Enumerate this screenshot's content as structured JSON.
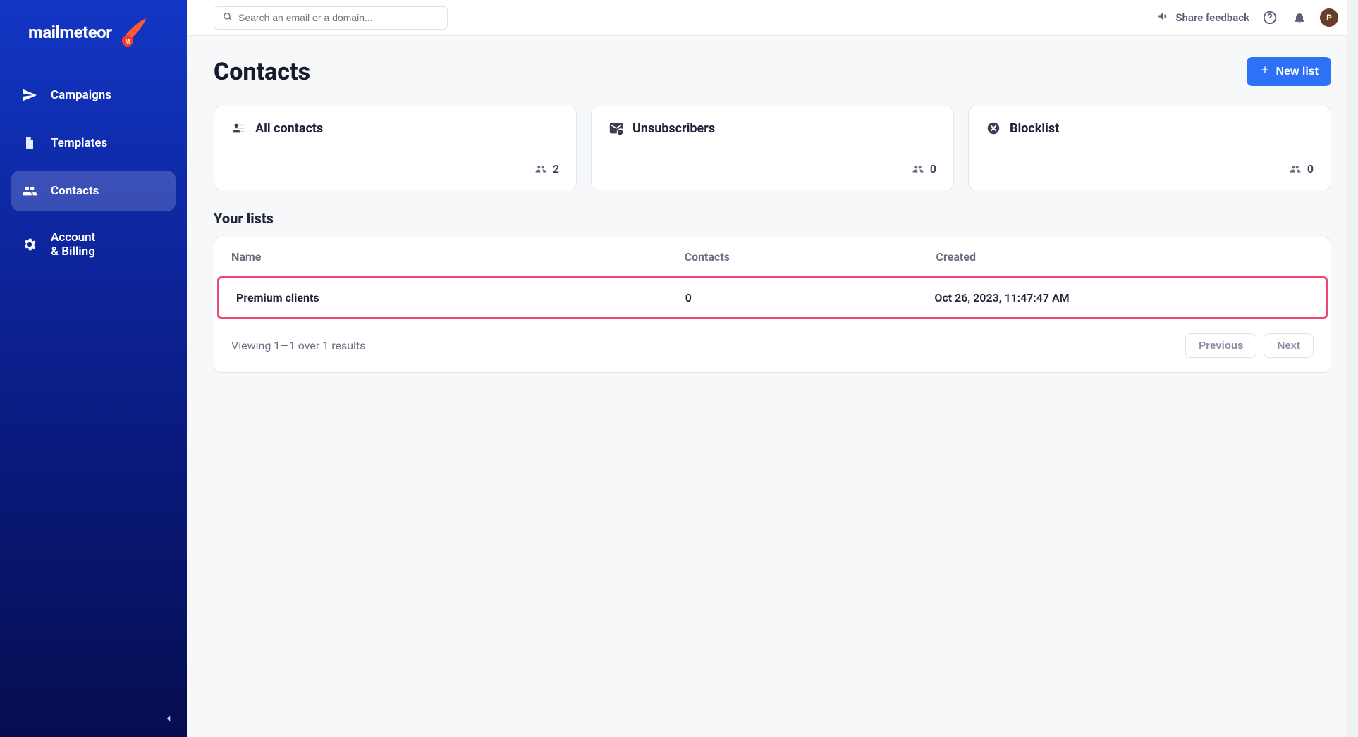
{
  "brand": {
    "name": "mailmeteor"
  },
  "sidebar": {
    "items": [
      {
        "label": "Campaigns"
      },
      {
        "label": "Templates"
      },
      {
        "label": "Contacts"
      },
      {
        "label_line1": "Account",
        "label_line2": "& Billing"
      }
    ]
  },
  "topbar": {
    "search_placeholder": "Search an email or a domain...",
    "share_feedback": "Share feedback",
    "avatar_initial": "P"
  },
  "page": {
    "title": "Contacts",
    "new_list_label": "New list",
    "cards": [
      {
        "title": "All contacts",
        "count": "2"
      },
      {
        "title": "Unsubscribers",
        "count": "0"
      },
      {
        "title": "Blocklist",
        "count": "0"
      }
    ],
    "lists_heading": "Your lists",
    "table": {
      "columns": {
        "name": "Name",
        "contacts": "Contacts",
        "created": "Created"
      },
      "rows": [
        {
          "name": "Premium clients",
          "contacts": "0",
          "created": "Oct 26, 2023, 11:47:47 AM"
        }
      ],
      "footer_text": "Viewing 1—1 over 1 results",
      "prev_label": "Previous",
      "next_label": "Next"
    }
  }
}
